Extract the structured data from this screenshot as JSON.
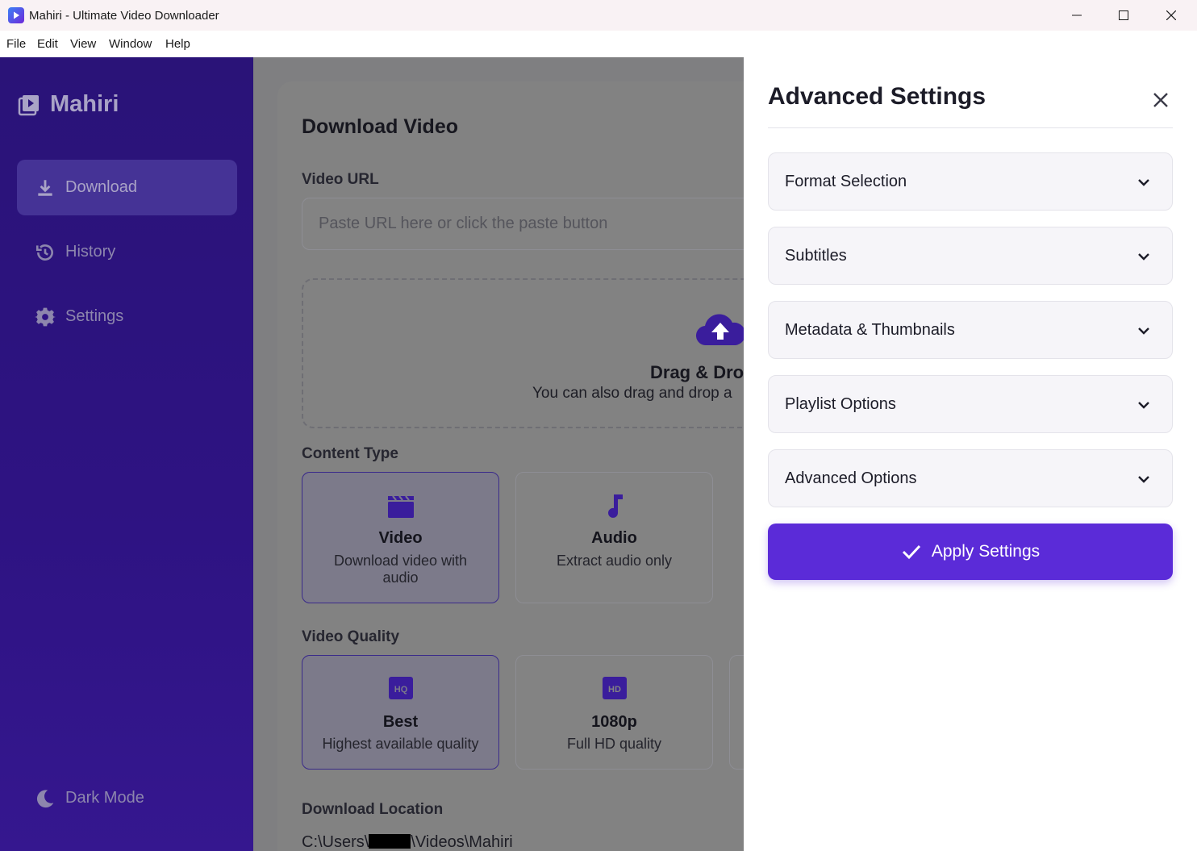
{
  "window": {
    "title": "Mahiri - Ultimate Video Downloader"
  },
  "menu": [
    "File",
    "Edit",
    "View",
    "Window",
    "Help"
  ],
  "sidebar": {
    "brand": "Mahiri",
    "items": [
      {
        "label": "Download",
        "icon": "download-icon",
        "active": true
      },
      {
        "label": "History",
        "icon": "history-icon",
        "active": false
      },
      {
        "label": "Settings",
        "icon": "gear-icon",
        "active": false
      }
    ],
    "dark_mode_label": "Dark Mode"
  },
  "main": {
    "title": "Download Video",
    "url_label": "Video URL",
    "url_placeholder": "Paste URL here or click the paste button",
    "drop_title": "Drag & Drop",
    "drop_subtitle": "You can also drag and drop a",
    "content_type_label": "Content Type",
    "content_types": [
      {
        "title": "Video",
        "subtitle": "Download video with audio",
        "icon": "clapperboard-icon",
        "selected": true
      },
      {
        "title": "Audio",
        "subtitle": "Extract audio only",
        "icon": "music-note-icon",
        "selected": false
      }
    ],
    "quality_label": "Video Quality",
    "qualities": [
      {
        "title": "Best",
        "subtitle": "Highest available quality",
        "icon": "hq-icon",
        "selected": true
      },
      {
        "title": "1080p",
        "subtitle": "Full HD quality",
        "icon": "hd-icon",
        "selected": false
      }
    ],
    "location_label": "Download Location",
    "path_prefix": "C:\\Users\\",
    "path_suffix": "\\Videos\\Mahiri"
  },
  "panel": {
    "title": "Advanced Settings",
    "sections": [
      "Format Selection",
      "Subtitles",
      "Metadata & Thumbnails",
      "Playlist Options",
      "Advanced Options"
    ],
    "apply_label": "Apply Settings"
  },
  "colors": {
    "accent": "#5b2bd8",
    "sidebar": "#2e1383",
    "overlay": "#7f7f81"
  }
}
